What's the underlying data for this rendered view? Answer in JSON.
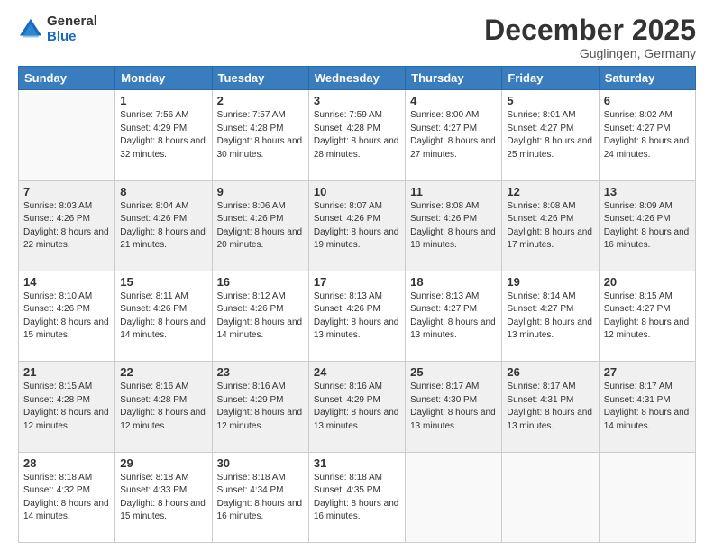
{
  "logo": {
    "general": "General",
    "blue": "Blue"
  },
  "header": {
    "title": "December 2025",
    "subtitle": "Guglingen, Germany"
  },
  "weekdays": [
    "Sunday",
    "Monday",
    "Tuesday",
    "Wednesday",
    "Thursday",
    "Friday",
    "Saturday"
  ],
  "weeks": [
    [
      {
        "day": "",
        "sunrise": "",
        "sunset": "",
        "daylight": ""
      },
      {
        "day": "1",
        "sunrise": "Sunrise: 7:56 AM",
        "sunset": "Sunset: 4:29 PM",
        "daylight": "Daylight: 8 hours and 32 minutes."
      },
      {
        "day": "2",
        "sunrise": "Sunrise: 7:57 AM",
        "sunset": "Sunset: 4:28 PM",
        "daylight": "Daylight: 8 hours and 30 minutes."
      },
      {
        "day": "3",
        "sunrise": "Sunrise: 7:59 AM",
        "sunset": "Sunset: 4:28 PM",
        "daylight": "Daylight: 8 hours and 28 minutes."
      },
      {
        "day": "4",
        "sunrise": "Sunrise: 8:00 AM",
        "sunset": "Sunset: 4:27 PM",
        "daylight": "Daylight: 8 hours and 27 minutes."
      },
      {
        "day": "5",
        "sunrise": "Sunrise: 8:01 AM",
        "sunset": "Sunset: 4:27 PM",
        "daylight": "Daylight: 8 hours and 25 minutes."
      },
      {
        "day": "6",
        "sunrise": "Sunrise: 8:02 AM",
        "sunset": "Sunset: 4:27 PM",
        "daylight": "Daylight: 8 hours and 24 minutes."
      }
    ],
    [
      {
        "day": "7",
        "sunrise": "Sunrise: 8:03 AM",
        "sunset": "Sunset: 4:26 PM",
        "daylight": "Daylight: 8 hours and 22 minutes."
      },
      {
        "day": "8",
        "sunrise": "Sunrise: 8:04 AM",
        "sunset": "Sunset: 4:26 PM",
        "daylight": "Daylight: 8 hours and 21 minutes."
      },
      {
        "day": "9",
        "sunrise": "Sunrise: 8:06 AM",
        "sunset": "Sunset: 4:26 PM",
        "daylight": "Daylight: 8 hours and 20 minutes."
      },
      {
        "day": "10",
        "sunrise": "Sunrise: 8:07 AM",
        "sunset": "Sunset: 4:26 PM",
        "daylight": "Daylight: 8 hours and 19 minutes."
      },
      {
        "day": "11",
        "sunrise": "Sunrise: 8:08 AM",
        "sunset": "Sunset: 4:26 PM",
        "daylight": "Daylight: 8 hours and 18 minutes."
      },
      {
        "day": "12",
        "sunrise": "Sunrise: 8:08 AM",
        "sunset": "Sunset: 4:26 PM",
        "daylight": "Daylight: 8 hours and 17 minutes."
      },
      {
        "day": "13",
        "sunrise": "Sunrise: 8:09 AM",
        "sunset": "Sunset: 4:26 PM",
        "daylight": "Daylight: 8 hours and 16 minutes."
      }
    ],
    [
      {
        "day": "14",
        "sunrise": "Sunrise: 8:10 AM",
        "sunset": "Sunset: 4:26 PM",
        "daylight": "Daylight: 8 hours and 15 minutes."
      },
      {
        "day": "15",
        "sunrise": "Sunrise: 8:11 AM",
        "sunset": "Sunset: 4:26 PM",
        "daylight": "Daylight: 8 hours and 14 minutes."
      },
      {
        "day": "16",
        "sunrise": "Sunrise: 8:12 AM",
        "sunset": "Sunset: 4:26 PM",
        "daylight": "Daylight: 8 hours and 14 minutes."
      },
      {
        "day": "17",
        "sunrise": "Sunrise: 8:13 AM",
        "sunset": "Sunset: 4:26 PM",
        "daylight": "Daylight: 8 hours and 13 minutes."
      },
      {
        "day": "18",
        "sunrise": "Sunrise: 8:13 AM",
        "sunset": "Sunset: 4:27 PM",
        "daylight": "Daylight: 8 hours and 13 minutes."
      },
      {
        "day": "19",
        "sunrise": "Sunrise: 8:14 AM",
        "sunset": "Sunset: 4:27 PM",
        "daylight": "Daylight: 8 hours and 13 minutes."
      },
      {
        "day": "20",
        "sunrise": "Sunrise: 8:15 AM",
        "sunset": "Sunset: 4:27 PM",
        "daylight": "Daylight: 8 hours and 12 minutes."
      }
    ],
    [
      {
        "day": "21",
        "sunrise": "Sunrise: 8:15 AM",
        "sunset": "Sunset: 4:28 PM",
        "daylight": "Daylight: 8 hours and 12 minutes."
      },
      {
        "day": "22",
        "sunrise": "Sunrise: 8:16 AM",
        "sunset": "Sunset: 4:28 PM",
        "daylight": "Daylight: 8 hours and 12 minutes."
      },
      {
        "day": "23",
        "sunrise": "Sunrise: 8:16 AM",
        "sunset": "Sunset: 4:29 PM",
        "daylight": "Daylight: 8 hours and 12 minutes."
      },
      {
        "day": "24",
        "sunrise": "Sunrise: 8:16 AM",
        "sunset": "Sunset: 4:29 PM",
        "daylight": "Daylight: 8 hours and 13 minutes."
      },
      {
        "day": "25",
        "sunrise": "Sunrise: 8:17 AM",
        "sunset": "Sunset: 4:30 PM",
        "daylight": "Daylight: 8 hours and 13 minutes."
      },
      {
        "day": "26",
        "sunrise": "Sunrise: 8:17 AM",
        "sunset": "Sunset: 4:31 PM",
        "daylight": "Daylight: 8 hours and 13 minutes."
      },
      {
        "day": "27",
        "sunrise": "Sunrise: 8:17 AM",
        "sunset": "Sunset: 4:31 PM",
        "daylight": "Daylight: 8 hours and 14 minutes."
      }
    ],
    [
      {
        "day": "28",
        "sunrise": "Sunrise: 8:18 AM",
        "sunset": "Sunset: 4:32 PM",
        "daylight": "Daylight: 8 hours and 14 minutes."
      },
      {
        "day": "29",
        "sunrise": "Sunrise: 8:18 AM",
        "sunset": "Sunset: 4:33 PM",
        "daylight": "Daylight: 8 hours and 15 minutes."
      },
      {
        "day": "30",
        "sunrise": "Sunrise: 8:18 AM",
        "sunset": "Sunset: 4:34 PM",
        "daylight": "Daylight: 8 hours and 16 minutes."
      },
      {
        "day": "31",
        "sunrise": "Sunrise: 8:18 AM",
        "sunset": "Sunset: 4:35 PM",
        "daylight": "Daylight: 8 hours and 16 minutes."
      },
      {
        "day": "",
        "sunrise": "",
        "sunset": "",
        "daylight": ""
      },
      {
        "day": "",
        "sunrise": "",
        "sunset": "",
        "daylight": ""
      },
      {
        "day": "",
        "sunrise": "",
        "sunset": "",
        "daylight": ""
      }
    ]
  ]
}
